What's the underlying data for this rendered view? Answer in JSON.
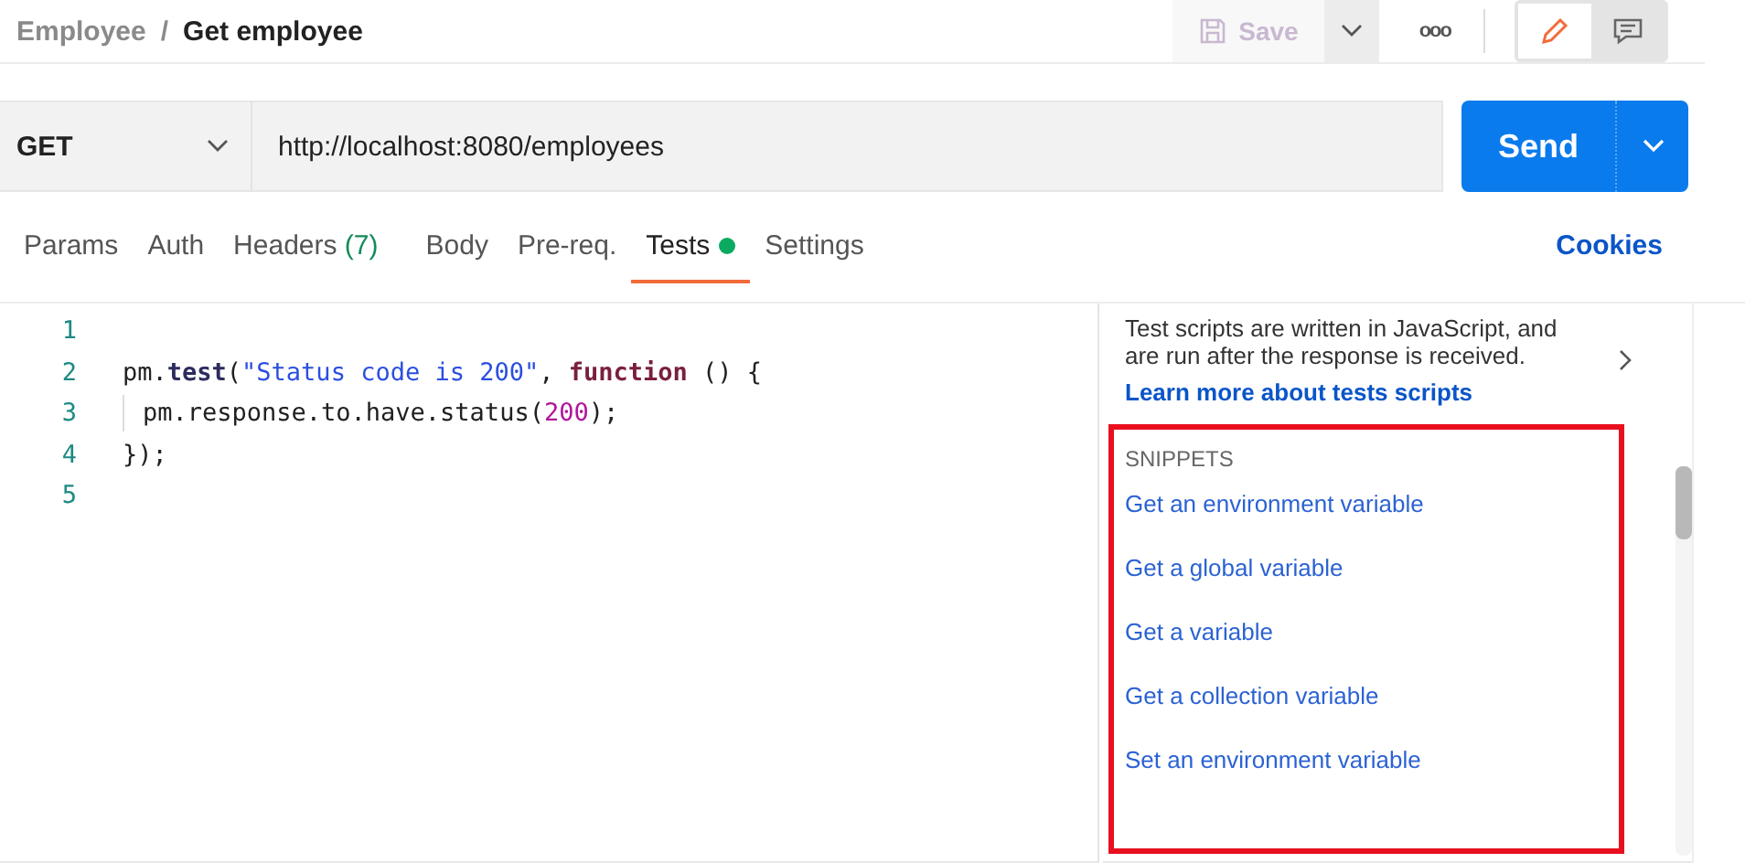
{
  "breadcrumb": {
    "parent": "Employee",
    "separator": "/",
    "current": "Get employee"
  },
  "toolbar": {
    "save_label": "Save",
    "more_label": "ooo"
  },
  "request": {
    "method": "GET",
    "url": "http://localhost:8080/employees",
    "send_label": "Send"
  },
  "tabs": [
    {
      "label": "Params",
      "selected": false
    },
    {
      "label": "Auth",
      "selected": false
    },
    {
      "label": "Headers",
      "count": "(7)",
      "selected": false
    },
    {
      "label": "Body",
      "selected": false
    },
    {
      "label": "Pre-req.",
      "selected": false
    },
    {
      "label": "Tests",
      "dot": true,
      "selected": true
    },
    {
      "label": "Settings",
      "selected": false
    }
  ],
  "cookies_link": "Cookies",
  "editor": {
    "lines": [
      {
        "number": "1"
      },
      {
        "number": "2",
        "tokens": [
          {
            "kind": "plain",
            "text": "pm."
          },
          {
            "kind": "method",
            "text": "test"
          },
          {
            "kind": "plain",
            "text": "("
          },
          {
            "kind": "string",
            "text": "\"Status code is 200\""
          },
          {
            "kind": "plain",
            "text": ", "
          },
          {
            "kind": "keyword",
            "text": "function"
          },
          {
            "kind": "plain",
            "text": " () {"
          }
        ]
      },
      {
        "number": "3",
        "indent": true,
        "tokens": [
          {
            "kind": "plain",
            "text": "pm.response.to.have.status("
          },
          {
            "kind": "number",
            "text": "200"
          },
          {
            "kind": "plain",
            "text": ");"
          }
        ]
      },
      {
        "number": "4",
        "tokens": [
          {
            "kind": "plain",
            "text": "});"
          }
        ]
      },
      {
        "number": "5"
      }
    ]
  },
  "side_panel": {
    "description": "Test scripts are written in JavaScript, and are run after the response is received.",
    "learn_link": "Learn more about tests scripts",
    "snippets_heading": "SNIPPETS",
    "snippets": [
      "Get an environment variable",
      "Get a global variable",
      "Get a variable",
      "Get a collection variable",
      "Set an environment variable"
    ]
  }
}
